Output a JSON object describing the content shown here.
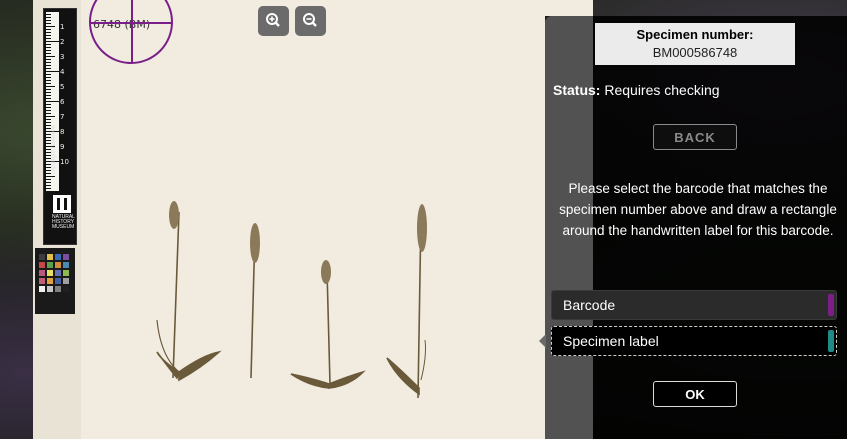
{
  "specimen": {
    "number_label": "Specimen number:",
    "number_value": "BM000586748"
  },
  "status": {
    "label": "Status:",
    "value": "Requires checking"
  },
  "buttons": {
    "back": "BACK",
    "ok": "OK"
  },
  "zoom": {
    "zoom_in_icon": "zoom-in-icon",
    "zoom_out_icon": "zoom-out-icon"
  },
  "instructions": "Please select the barcode that matches the specimen number above and draw a rectangle around the handwritten label for this barcode.",
  "options": [
    {
      "label": "Barcode",
      "color": "#7b1f86"
    },
    {
      "label": "Specimen label",
      "color": "#1f8a86"
    }
  ],
  "image": {
    "barcode_text": "6748 (BM)",
    "ruler_numbers": [
      "1",
      "2",
      "3",
      "4",
      "5",
      "6",
      "7",
      "8",
      "9",
      "10"
    ],
    "ruler_copyright": "copyright reserved",
    "museum_name": "NATURAL HISTORY MUSEUM"
  }
}
